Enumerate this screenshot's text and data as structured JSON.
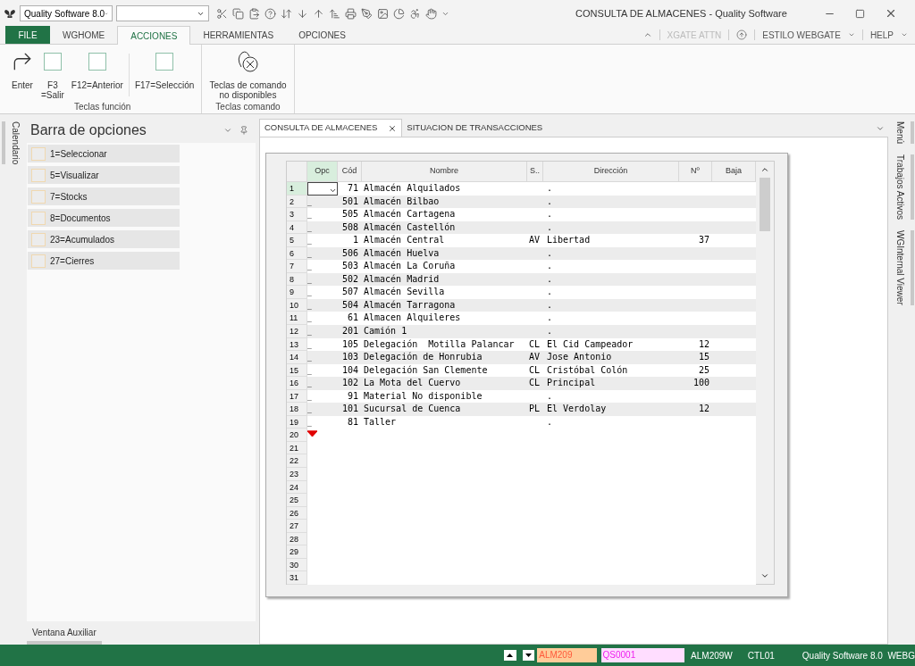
{
  "window": {
    "title": "CONSULTA DE ALMACENES  - Quality Software",
    "app_combo": "Quality Software 8.0"
  },
  "ribbon_tabs": [
    {
      "label": "FILE",
      "kind": "file",
      "selected": false
    },
    {
      "label": "WGHOME",
      "kind": "tab",
      "selected": false
    },
    {
      "label": "ACCIONES",
      "kind": "tab",
      "selected": true
    },
    {
      "label": "HERRAMIENTAS",
      "kind": "tab",
      "selected": false
    },
    {
      "label": "OPCIONES",
      "kind": "tab",
      "selected": false
    }
  ],
  "ribbon_right": {
    "xgate": "XGATE ATTN",
    "style": "ESTILO WEBGATE",
    "help": "HELP"
  },
  "ribbon_groups": [
    {
      "title": "Teclas función",
      "buttons": [
        {
          "label": "Enter",
          "kind": "enter"
        },
        {
          "label": "F3\n=Salir",
          "kind": "key"
        },
        {
          "label": "F12=Anterior",
          "kind": "key"
        },
        {
          "label": "F17=Selección",
          "kind": "key",
          "separated": true
        }
      ]
    },
    {
      "title": "Teclas comando",
      "buttons": [
        {
          "label": "Teclas de comando\nno disponibles",
          "kind": "none"
        }
      ]
    }
  ],
  "left_tabs": [
    "Calendario"
  ],
  "right_tabs": [
    "Menú",
    "Trabajos Activos",
    "WGInternal Viewer"
  ],
  "options_bar": {
    "title": "Barra de opciones",
    "items": [
      "1=Seleccionar",
      "5=Visualizar",
      "7=Stocks",
      "8=Documentos",
      "23=Acumulados",
      "27=Cierres"
    ],
    "footer": "Ventana Auxiliar"
  },
  "doc_tabs": [
    {
      "label": "CONSULTA DE ALMACENES",
      "selected": true,
      "closable": true
    },
    {
      "label": "SITUACION DE TRANSACCIONES",
      "selected": false,
      "closable": false
    }
  ],
  "table": {
    "columns": [
      "Opc",
      "Cód",
      "Nombre",
      "S..",
      "Dirección",
      "Nº",
      "Baja"
    ],
    "rows": [
      {
        "n": "1",
        "opc": "",
        "selected": true,
        "cod": "71",
        "nombre": "Almacén Alquilados",
        "s": "",
        "dir": ".",
        "num": ""
      },
      {
        "n": "2",
        "opc": "_",
        "selected": false,
        "cod": "501",
        "nombre": "Almacén Bilbao",
        "s": "",
        "dir": ".",
        "num": ""
      },
      {
        "n": "3",
        "opc": "_",
        "selected": false,
        "cod": "505",
        "nombre": "Almacén Cartagena",
        "s": "",
        "dir": ".",
        "num": ""
      },
      {
        "n": "4",
        "opc": "_",
        "selected": false,
        "cod": "508",
        "nombre": "Almacén Castellón",
        "s": "",
        "dir": ".",
        "num": ""
      },
      {
        "n": "5",
        "opc": "_",
        "selected": false,
        "cod": "1",
        "nombre": "Almacén Central",
        "s": "AV",
        "dir": "Libertad",
        "num": "37"
      },
      {
        "n": "6",
        "opc": "_",
        "selected": false,
        "cod": "506",
        "nombre": "Almacén Huelva",
        "s": "",
        "dir": ".",
        "num": ""
      },
      {
        "n": "7",
        "opc": "_",
        "selected": false,
        "cod": "503",
        "nombre": "Almacén La Coruña",
        "s": "",
        "dir": ".",
        "num": ""
      },
      {
        "n": "8",
        "opc": "_",
        "selected": false,
        "cod": "502",
        "nombre": "Almacén Madrid",
        "s": "",
        "dir": ".",
        "num": ""
      },
      {
        "n": "9",
        "opc": "_",
        "selected": false,
        "cod": "507",
        "nombre": "Almacén Sevilla",
        "s": "",
        "dir": ".",
        "num": ""
      },
      {
        "n": "10",
        "opc": "_",
        "selected": false,
        "cod": "504",
        "nombre": "Almacén Tarragona",
        "s": "",
        "dir": ".",
        "num": ""
      },
      {
        "n": "11",
        "opc": "_",
        "selected": false,
        "cod": "61",
        "nombre": "Almacen Alquileres",
        "s": "",
        "dir": ".",
        "num": ""
      },
      {
        "n": "12",
        "opc": "_",
        "selected": false,
        "cod": "201",
        "nombre": "Camión 1",
        "s": "",
        "dir": ".",
        "num": ""
      },
      {
        "n": "13",
        "opc": "_",
        "selected": false,
        "cod": "105",
        "nombre": "Delegación  Motilla Palancar",
        "s": "CL",
        "dir": "El Cid Campeador",
        "num": "12"
      },
      {
        "n": "14",
        "opc": "_",
        "selected": false,
        "cod": "103",
        "nombre": "Delegación de Honrubia",
        "s": "AV",
        "dir": "Jose Antonio",
        "num": "15"
      },
      {
        "n": "15",
        "opc": "_",
        "selected": false,
        "cod": "104",
        "nombre": "Delegación San Clemente",
        "s": "CL",
        "dir": "Cristóbal Colón",
        "num": "25"
      },
      {
        "n": "16",
        "opc": "_",
        "selected": false,
        "cod": "102",
        "nombre": "La Mota del Cuervo",
        "s": "CL",
        "dir": "Principal",
        "num": "100"
      },
      {
        "n": "17",
        "opc": "_",
        "selected": false,
        "cod": "91",
        "nombre": "Material No disponible",
        "s": "",
        "dir": ".",
        "num": ""
      },
      {
        "n": "18",
        "opc": "_",
        "selected": false,
        "cod": "101",
        "nombre": "Sucursal de Cuenca",
        "s": "PL",
        "dir": "El Verdolay",
        "num": "12"
      },
      {
        "n": "19",
        "opc": "_",
        "selected": false,
        "cod": "81",
        "nombre": "Taller",
        "s": "",
        "dir": ".",
        "num": ""
      },
      {
        "n": "20",
        "end_marker": true
      },
      {
        "n": "21"
      },
      {
        "n": "22"
      },
      {
        "n": "23"
      },
      {
        "n": "24"
      },
      {
        "n": "25"
      },
      {
        "n": "26"
      },
      {
        "n": "27"
      },
      {
        "n": "28"
      },
      {
        "n": "29"
      },
      {
        "n": "30"
      },
      {
        "n": "31"
      }
    ]
  },
  "status_bar": {
    "program": "ALM209",
    "user": "QS0001",
    "screen": "ALM209W",
    "ctl": "CTL01",
    "product": "Quality Software 8.0  WEBG"
  }
}
